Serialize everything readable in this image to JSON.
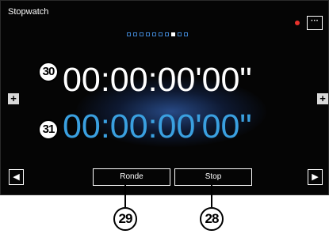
{
  "app": {
    "title": "Stopwatch",
    "menu_label": "···"
  },
  "status": {
    "recording_indicator_color": "#e8322c"
  },
  "pager": {
    "count": 10,
    "active_index": 7
  },
  "timers": {
    "main": {
      "marker": "30",
      "value": "00:00:00'00\"",
      "color": "#ffffff"
    },
    "lap": {
      "marker": "31",
      "value": "00:00:00'00\"",
      "color": "#3aa0e0"
    }
  },
  "side_controls": {
    "left_label": "+",
    "right_label": "+"
  },
  "nav": {
    "prev_label": "◀",
    "next_label": "▶"
  },
  "actions": {
    "lap_label": "Ronde",
    "stop_label": "Stop"
  },
  "callouts": {
    "lap_button_marker": "29",
    "stop_button_marker": "28"
  },
  "colors": {
    "accent_blue": "#3aa0e0",
    "background": "#050505"
  }
}
